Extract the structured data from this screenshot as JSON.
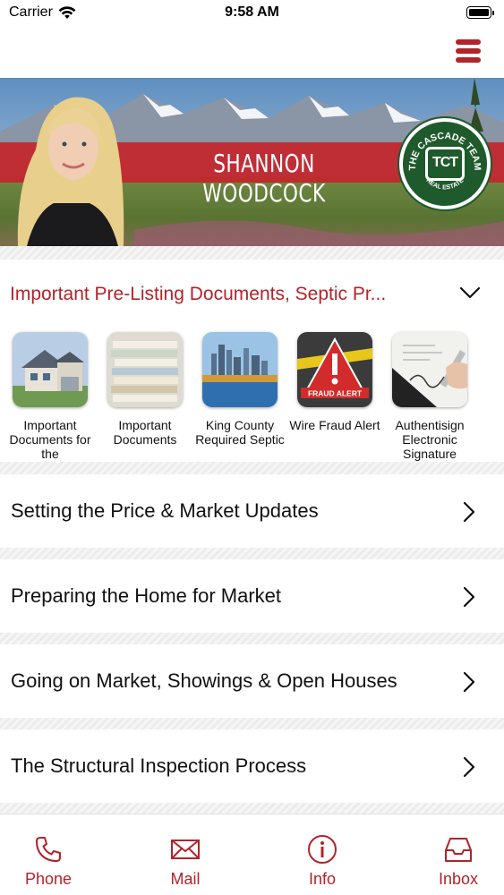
{
  "status_bar": {
    "carrier": "Carrier",
    "time": "9:58 AM"
  },
  "header": {
    "menu_icon": "hamburger-menu-icon"
  },
  "banner": {
    "agent_name": "SHANNON WOODCOCK",
    "logo_text_top": "THE CASCADE TEAM",
    "logo_text_bottom": "REAL ESTATE",
    "logo_monogram": "TCT"
  },
  "section": {
    "title": "Important Pre-Listing Documents, Septic Pr...",
    "expanded": true,
    "documents": [
      {
        "label": "Important Documents for the"
      },
      {
        "label": "Important Documents"
      },
      {
        "label": "King County Required Septic"
      },
      {
        "label": "Wire Fraud Alert",
        "badge": "FRAUD ALERT"
      },
      {
        "label": "Authentisign Electronic Signature"
      }
    ]
  },
  "list_items": [
    {
      "label": "Setting the Price & Market Updates"
    },
    {
      "label": "Preparing the Home for Market"
    },
    {
      "label": "Going on Market, Showings & Open Houses"
    },
    {
      "label": "The Structural Inspection Process"
    }
  ],
  "tab_bar": {
    "tabs": [
      {
        "label": "Phone",
        "icon": "phone-icon"
      },
      {
        "label": "Mail",
        "icon": "mail-icon"
      },
      {
        "label": "Info",
        "icon": "info-icon"
      },
      {
        "label": "Inbox",
        "icon": "inbox-icon"
      }
    ]
  },
  "colors": {
    "accent": "#b1242a",
    "banner_stripe": "#c3262c",
    "logo_green": "#1f5a2c"
  }
}
